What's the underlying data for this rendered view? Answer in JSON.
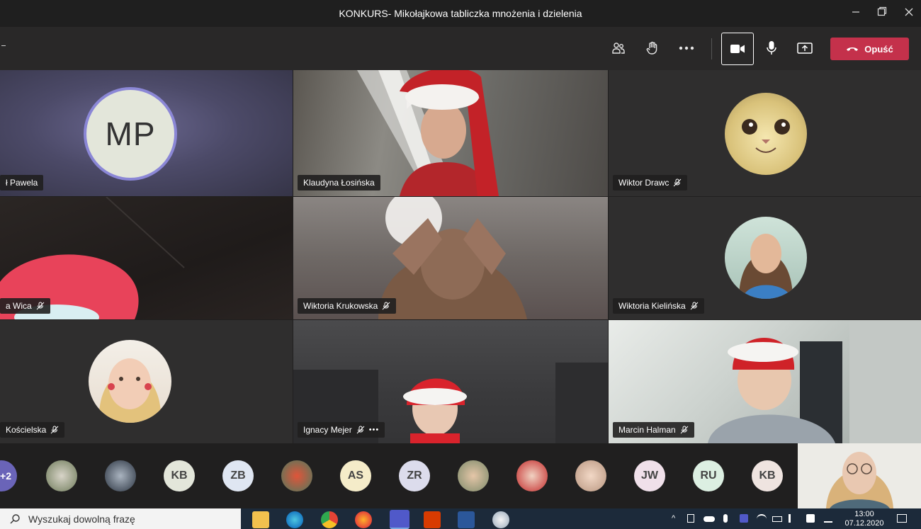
{
  "window": {
    "title": "KONKURS- Mikołajkowa tabliczka mnożenia i dzielenia",
    "minimize_icon": "minimize-icon",
    "maximize_icon": "restore-icon",
    "close_icon": "close-icon"
  },
  "toolbar": {
    "leave_label": "Opuść",
    "accent": "#c4314b"
  },
  "participants": [
    {
      "name": "ł Pawela",
      "initials": "MP",
      "muted": false
    },
    {
      "name": "Klaudyna Łosińska",
      "muted": false
    },
    {
      "name": "Wiktor Drawc",
      "muted": true
    },
    {
      "name": "a Wica",
      "muted": true
    },
    {
      "name": "Wiktoria Krukowska",
      "muted": true
    },
    {
      "name": "Wiktoria Kielińska",
      "muted": true
    },
    {
      "name": "Kościelska",
      "muted": true
    },
    {
      "name": "Ignacy Mejer",
      "muted": true,
      "more": "•••"
    },
    {
      "name": "Marcin Halman",
      "muted": true
    }
  ],
  "strip": {
    "overflow": "+2",
    "chips": [
      "KB",
      "ZB",
      "AS",
      "ZR",
      "JW",
      "RU",
      "KB"
    ]
  },
  "taskbar": {
    "search_placeholder": "Wyszukaj dowolną frazę",
    "time": "13:00",
    "date": "07.12.2020"
  }
}
